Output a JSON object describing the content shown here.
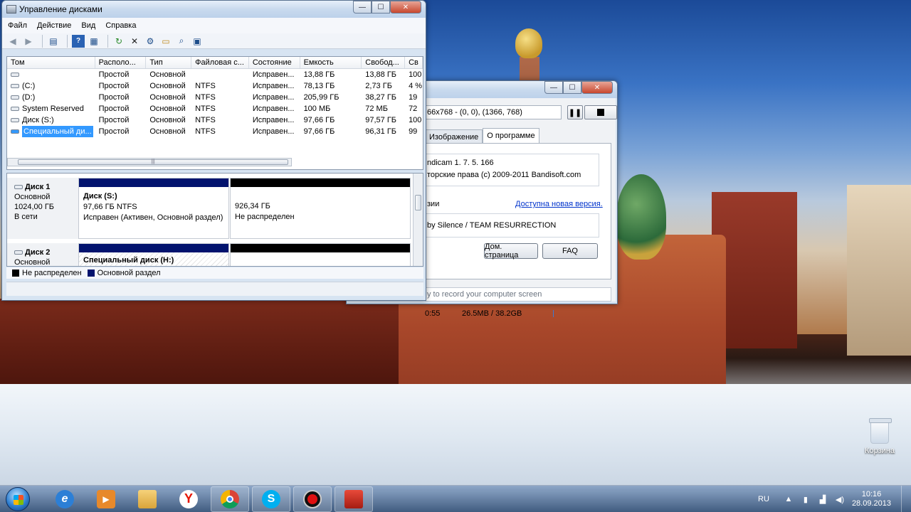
{
  "disk_mgmt": {
    "title": "Управление дисками",
    "menu": [
      "Файл",
      "Действие",
      "Вид",
      "Справка"
    ],
    "columns": [
      "Том",
      "Располо...",
      "Тип",
      "Файловая с...",
      "Состояние",
      "Емкость",
      "Свобод...",
      "Св"
    ],
    "rows": [
      [
        "",
        "Простой",
        "Основной",
        "",
        "Исправен...",
        "13,88 ГБ",
        "13,88 ГБ",
        "100"
      ],
      [
        "(C:)",
        "Простой",
        "Основной",
        "NTFS",
        "Исправен...",
        "78,13 ГБ",
        "2,73 ГБ",
        "4 %"
      ],
      [
        "(D:)",
        "Простой",
        "Основной",
        "NTFS",
        "Исправен...",
        "205,99 ГБ",
        "38,27 ГБ",
        "19"
      ],
      [
        "System Reserved",
        "Простой",
        "Основной",
        "NTFS",
        "Исправен...",
        "100 МБ",
        "72 МБ",
        "72"
      ],
      [
        "Диск (S:)",
        "Простой",
        "Основной",
        "NTFS",
        "Исправен...",
        "97,66 ГБ",
        "97,57 ГБ",
        "100"
      ],
      [
        "Специальный ди...",
        "Простой",
        "Основной",
        "NTFS",
        "Исправен...",
        "97,66 ГБ",
        "96,31 ГБ",
        "99"
      ]
    ],
    "disks": [
      {
        "name": "Диск 1",
        "type": "Основной",
        "size": "1024,00 ГБ",
        "state": "В сети",
        "part1": {
          "name": "Диск  (S:)",
          "line2": "97,66 ГБ NTFS",
          "line3": "Исправен (Активен, Основной раздел)"
        },
        "part2": {
          "line1": "926,34 ГБ",
          "line2": "Не распределен"
        }
      },
      {
        "name": "Диск 2",
        "type": "Основной",
        "part1": {
          "name": "Специальный диск  (H:)"
        }
      }
    ],
    "legend": {
      "unallocated": "Не распределен",
      "primary": "Основной раздел"
    }
  },
  "bandicam": {
    "resolution": "66x768 - (0, 0), (1366, 768)",
    "tabs": [
      "Изображение",
      "О программе"
    ],
    "version": "ndicam 1. 7. 5. 166",
    "copyright": "торские права (c) 2009-2011 Bandisoft.com",
    "label_versions": "зии",
    "new_version_link": "Доступна новая версия.",
    "credits": "by Silence / TEAM RESURRECTION",
    "homepage_button": "Дом. страница",
    "faq_button": "FAQ",
    "tagline": "y to record your computer screen",
    "time": "0:55",
    "size": "26.5MB / 38.2GB"
  },
  "desktop": {
    "recycle_bin": "Корзина"
  },
  "taskbar": {
    "lang": "RU",
    "time": "10:16",
    "date": "28.09.2013"
  },
  "colors": {
    "primary_partition": "#02136e",
    "unallocated": "#000000",
    "selection": "#3399ff"
  }
}
